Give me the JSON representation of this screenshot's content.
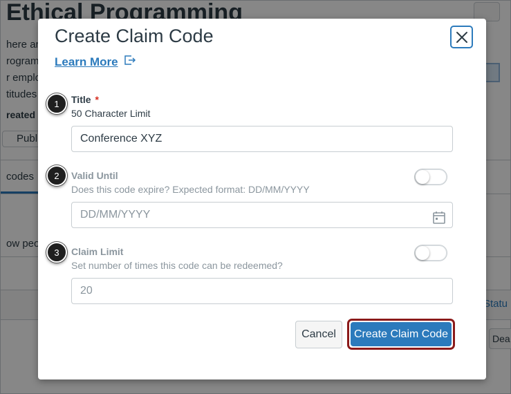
{
  "background": {
    "title": "Ethical Programming",
    "lines": [
      "here ar",
      "rogram",
      "r emplo",
      "titudes"
    ],
    "created_label": "reated o",
    "publish_label": "Publ",
    "tab_label": "codes",
    "row_text": "ow peo",
    "status_label": "Statu",
    "deactivate_label": "Dea"
  },
  "modal": {
    "title": "Create Claim Code",
    "learn_more": "Learn More",
    "steps": [
      "1",
      "2",
      "3"
    ],
    "title_field": {
      "label": "Title",
      "required_marker": "*",
      "help": "50 Character Limit",
      "value": "Conference XYZ"
    },
    "valid_until_field": {
      "label": "Valid Until",
      "help": "Does this code expire? Expected format: DD/MM/YYYY",
      "placeholder": "DD/MM/YYYY",
      "toggle_on": false
    },
    "claim_limit_field": {
      "label": "Claim Limit",
      "help": "Set number of times this code can be redeemed?",
      "placeholder": "20",
      "toggle_on": false
    },
    "buttons": {
      "cancel": "Cancel",
      "create": "Create Claim Code"
    }
  },
  "colors": {
    "accent": "#2b7abc",
    "text": "#2d3b45",
    "muted": "#8b969e",
    "required": "#d62d20",
    "highlight_border": "#8b1a1a"
  },
  "icons": {
    "close": "close-icon",
    "external": "external-link-icon",
    "calendar": "calendar-icon"
  }
}
